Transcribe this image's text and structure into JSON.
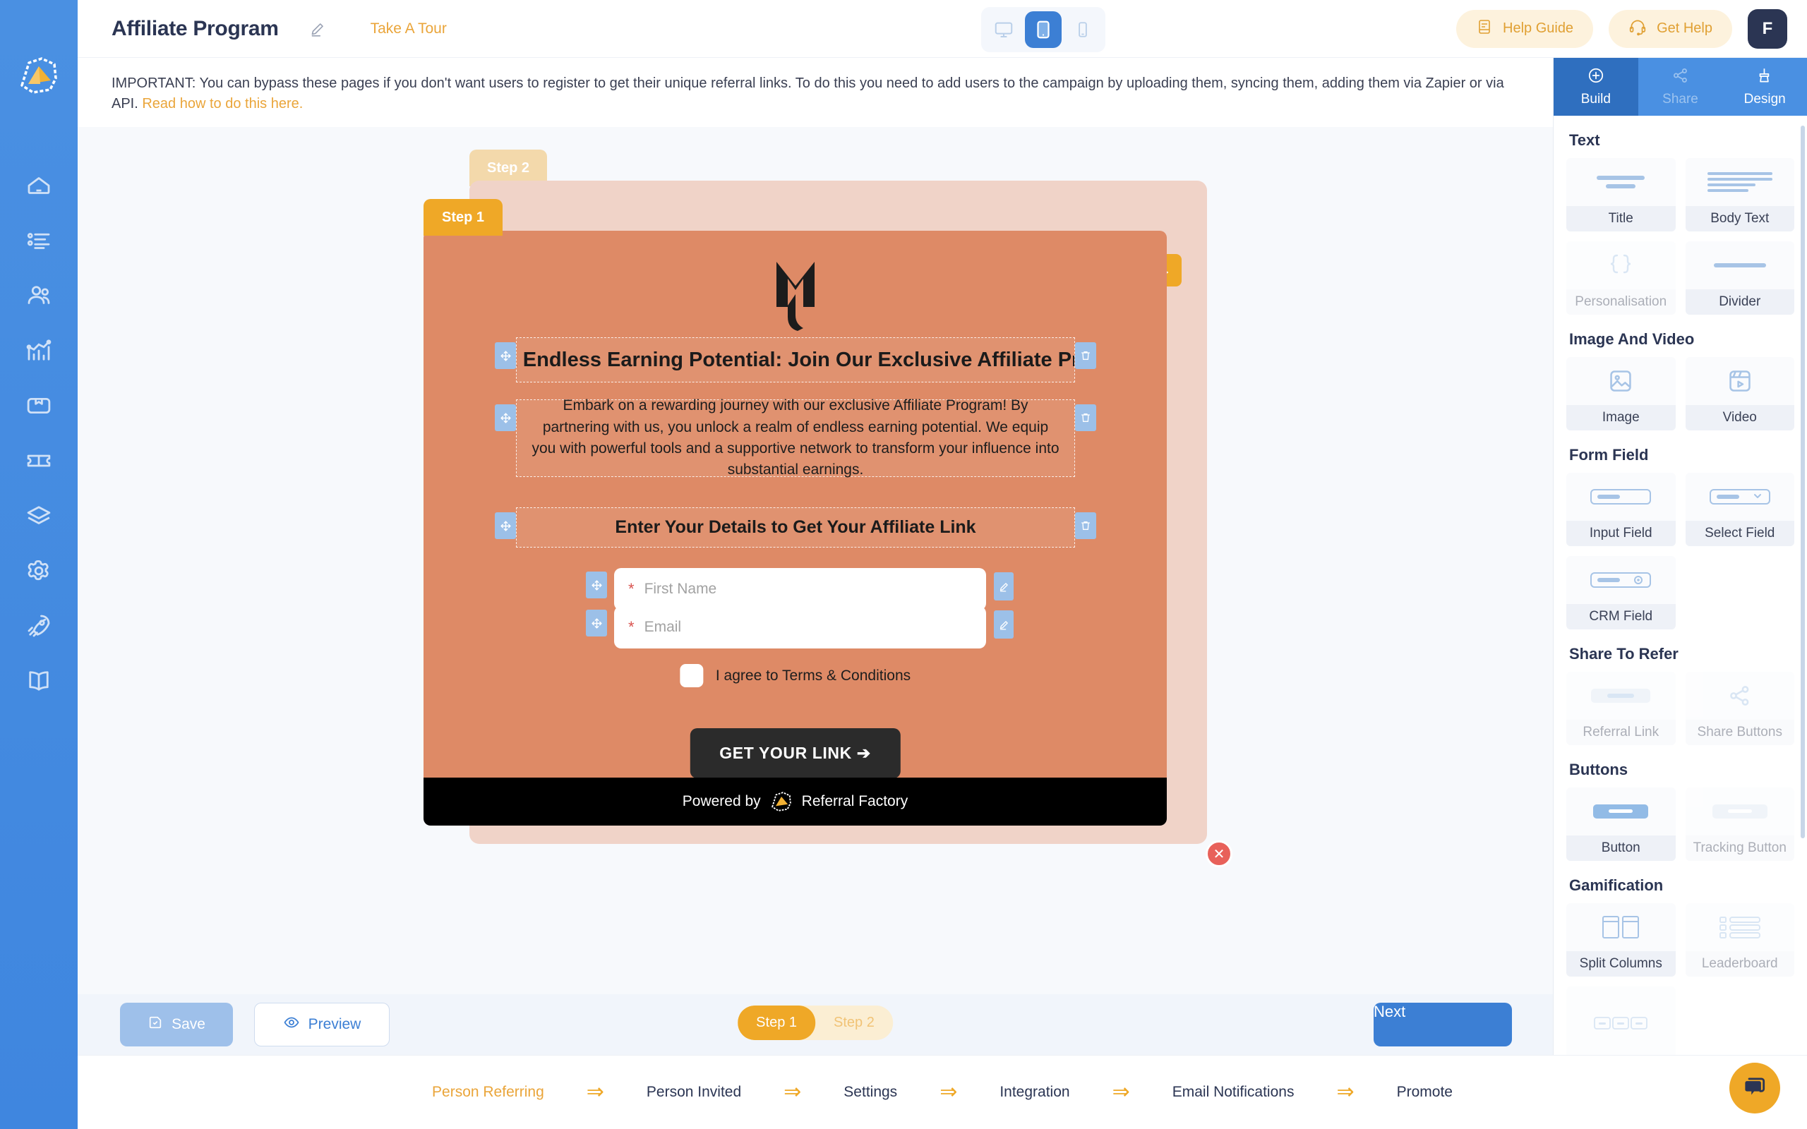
{
  "header": {
    "page_title": "Affiliate Program",
    "edit_icon": "pencil-icon",
    "take_a_tour": "Take A Tour",
    "help_guide": "Help Guide",
    "get_help": "Get Help",
    "avatar_initial": "F",
    "devices": [
      {
        "name": "desktop",
        "active": false
      },
      {
        "name": "tablet",
        "active": true
      },
      {
        "name": "mobile",
        "active": false
      }
    ]
  },
  "notice": {
    "text": "IMPORTANT: You can bypass these pages if you don't want users to register to get their unique referral links. To do this you need to add users to the campaign by uploading them, syncing them, adding them via Zapier or via API. ",
    "link_text": "Read how to do this here."
  },
  "canvas": {
    "step2_tab": "Step 2",
    "step1_tab": "Step 1",
    "prev_arrow": "←",
    "next_arrow": "→",
    "close_badge": "✕",
    "headline": "Unlock Endless Earning Potential: Join Our Exclusive Affiliate Program",
    "body": "Embark on a rewarding journey with our exclusive Affiliate Program! By partnering with us, you unlock a realm of endless earning potential. We equip you with powerful tools and a supportive network to transform your influence into substantial earnings.",
    "subheading": "Enter Your Details to Get Your Affiliate Link",
    "fields": [
      {
        "required": "*",
        "placeholder": "First Name"
      },
      {
        "required": "*",
        "placeholder": "Email"
      }
    ],
    "terms_label": "I agree to Terms & Conditions",
    "cta_label": "GET YOUR LINK  ➔",
    "footer_powered": "Powered by",
    "footer_brand": "Referral Factory"
  },
  "action_bar": {
    "save": "Save",
    "preview": "Preview",
    "next": "Next",
    "steps": [
      {
        "label": "Step 1",
        "active": true
      },
      {
        "label": "Step 2",
        "active": false
      }
    ]
  },
  "right_panel": {
    "tabs": [
      {
        "label": "Build",
        "icon": "plus-circle-icon",
        "active": true,
        "disabled": false
      },
      {
        "label": "Share",
        "icon": "share-nodes-icon",
        "active": false,
        "disabled": true
      },
      {
        "label": "Design",
        "icon": "paint-brush-icon",
        "active": false,
        "disabled": false
      }
    ],
    "sections": [
      {
        "title": "Text",
        "widgets": [
          {
            "label": "Title",
            "icon": "title-lines-icon",
            "dim": false
          },
          {
            "label": "Body Text",
            "icon": "body-lines-icon",
            "dim": false
          },
          {
            "label": "Personalisation",
            "icon": "curly-braces-icon",
            "dim": true
          },
          {
            "label": "Divider",
            "icon": "divider-line-icon",
            "dim": false
          }
        ]
      },
      {
        "title": "Image And Video",
        "widgets": [
          {
            "label": "Image",
            "icon": "image-icon",
            "dim": false
          },
          {
            "label": "Video",
            "icon": "video-clapper-icon",
            "dim": false
          }
        ]
      },
      {
        "title": "Form Field",
        "widgets": [
          {
            "label": "Input Field",
            "icon": "input-box-icon",
            "dim": false
          },
          {
            "label": "Select Field",
            "icon": "select-box-icon",
            "dim": false
          },
          {
            "label": "CRM Field",
            "icon": "crm-gear-box-icon",
            "dim": false
          }
        ]
      },
      {
        "title": "Share To Refer",
        "widgets": [
          {
            "label": "Referral Link",
            "icon": "referral-link-bar-icon",
            "dim": true
          },
          {
            "label": "Share Buttons",
            "icon": "share-nodes-icon",
            "dim": true
          }
        ]
      },
      {
        "title": "Buttons",
        "widgets": [
          {
            "label": "Button",
            "icon": "button-pill-icon",
            "dim": false
          },
          {
            "label": "Tracking Button",
            "icon": "tracking-button-pill-icon",
            "dim": true
          }
        ]
      },
      {
        "title": "Gamification",
        "widgets": [
          {
            "label": "Split Columns",
            "icon": "split-columns-icon",
            "dim": false
          },
          {
            "label": "Leaderboard",
            "icon": "leaderboard-list-icon",
            "dim": true
          }
        ]
      }
    ]
  },
  "bottom_nav": {
    "items": [
      {
        "label": "Person Referring",
        "active": true
      },
      {
        "label": "Person Invited",
        "active": false
      },
      {
        "label": "Settings",
        "active": false
      },
      {
        "label": "Integration",
        "active": false
      },
      {
        "label": "Email Notifications",
        "active": false
      },
      {
        "label": "Promote",
        "active": false
      }
    ],
    "separator": "⇒",
    "chat_icon": "chat-bubble-icon"
  },
  "sidebar": {
    "logo_icon": "referral-factory-logo-icon",
    "items": [
      {
        "icon": "home-pentagon-icon",
        "name": "home"
      },
      {
        "icon": "list-bullets-icon",
        "name": "campaigns"
      },
      {
        "icon": "users-icon",
        "name": "users"
      },
      {
        "icon": "analytics-chart-icon",
        "name": "analytics"
      },
      {
        "icon": "inbox-box-icon",
        "name": "rewards"
      },
      {
        "icon": "ticket-icon",
        "name": "vouchers"
      },
      {
        "icon": "layers-icon",
        "name": "integrations"
      },
      {
        "icon": "gear-icon",
        "name": "settings"
      },
      {
        "icon": "rocket-icon",
        "name": "promote"
      },
      {
        "icon": "book-icon",
        "name": "guide"
      }
    ]
  },
  "colors": {
    "brand_blue": "#4a90e2",
    "accent_orange": "#efa827",
    "card_orange": "#de8a66",
    "ghost_card": "#f0d3c8",
    "dark": "#2b3553"
  }
}
